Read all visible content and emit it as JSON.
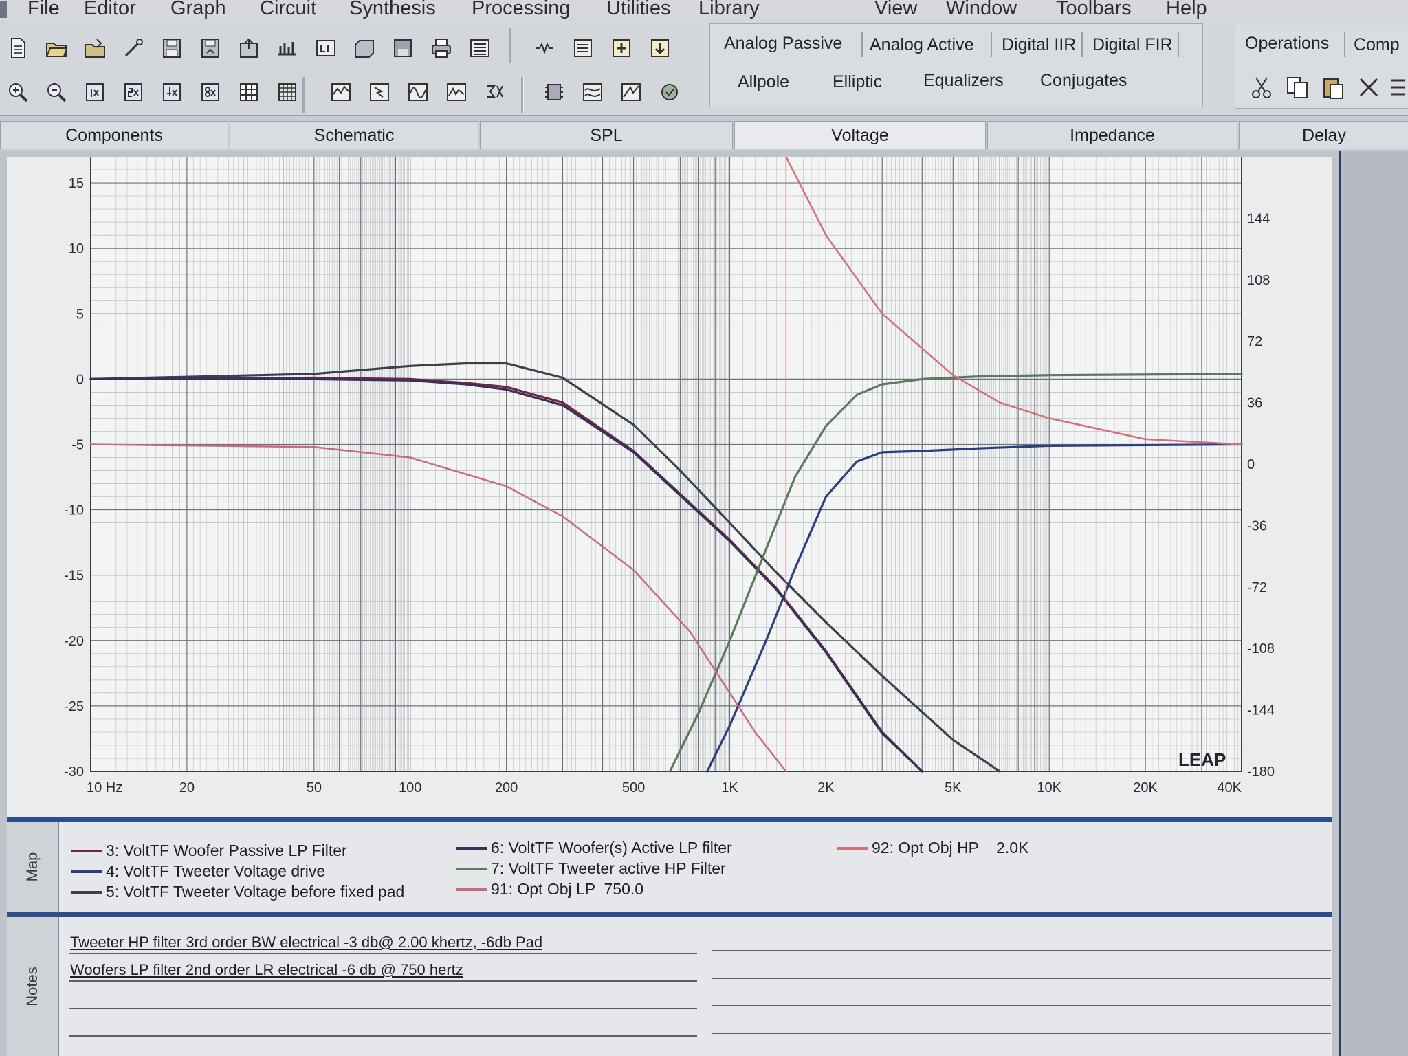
{
  "menu": [
    "File",
    "Editor",
    "Graph",
    "Circuit",
    "Synthesis",
    "Processing",
    "Utilities",
    "Library",
    "View",
    "Window",
    "Toolbars",
    "Help"
  ],
  "filter_tabs": {
    "row1": [
      "Analog Passive",
      "Analog Active",
      "Digital IIR",
      "Digital FIR"
    ],
    "row2": [
      "Allpole",
      "Elliptic",
      "Equalizers",
      "Conjugates"
    ]
  },
  "right_tabs": [
    "Operations",
    "Comp"
  ],
  "view_tabs": [
    "Components",
    "Schematic",
    "SPL",
    "Voltage",
    "Impedance",
    "Delay"
  ],
  "active_view_tab": "Voltage",
  "graph": {
    "watermark": "LEAP",
    "y_left_ticks": [
      "15",
      "10",
      "5",
      "0",
      "-5",
      "-10",
      "-15",
      "-20",
      "-25",
      "-30"
    ],
    "y_right_ticks": [
      "144",
      "108",
      "72",
      "36",
      "0",
      "-36",
      "-72",
      "-108",
      "-144",
      "-180"
    ],
    "x_ticks": [
      "10 Hz",
      "20",
      "50",
      "100",
      "200",
      "500",
      "1K",
      "2K",
      "5K",
      "10K",
      "20K",
      "40K"
    ]
  },
  "chart_data": {
    "type": "line",
    "xscale": "log",
    "xlim": [
      10,
      40000
    ],
    "ylim": [
      -30,
      17
    ],
    "ylim_right": [
      -180,
      180
    ],
    "grid": true,
    "series": [
      {
        "name": "3: VoltTF Woofer Passive LP Filter",
        "color": "#6b2a3e",
        "x": [
          10,
          50,
          100,
          150,
          200,
          300,
          500,
          700,
          1000,
          1400,
          2000,
          3000,
          4000
        ],
        "y": [
          0,
          0.1,
          0,
          -0.3,
          -0.6,
          -1.8,
          -5.5,
          -8.8,
          -12.3,
          -16,
          -20.8,
          -27,
          -31
        ]
      },
      {
        "name": "4: VoltTF Tweeter Voltage drive",
        "color": "#2c3f7c",
        "x": [
          850,
          1000,
          1300,
          1600,
          2000,
          2500,
          3000,
          4000,
          6000,
          10000,
          40000
        ],
        "y": [
          -30,
          -26.5,
          -20,
          -14.5,
          -9,
          -6.3,
          -5.6,
          -5.5,
          -5.3,
          -5.1,
          -5
        ]
      },
      {
        "name": "5: VoltTF Tweeter Voltage before fixed pad",
        "color": "#3c4048",
        "x": [
          10,
          50,
          100,
          150,
          200,
          300,
          500,
          700,
          1000,
          1400,
          2000,
          3000,
          5000,
          7000
        ],
        "y": [
          0,
          0.4,
          1,
          1.2,
          1.2,
          0.1,
          -3.5,
          -7,
          -11,
          -14.8,
          -18.6,
          -22.7,
          -27.6,
          -30.5
        ]
      },
      {
        "name": "6: VoltTF Woofer(s) Active LP filter",
        "color": "#3a2f5a",
        "x": [
          10,
          50,
          100,
          150,
          200,
          300,
          500,
          700,
          1000,
          1400,
          2000,
          3000,
          4000
        ],
        "y": [
          0,
          0,
          -0.1,
          -0.4,
          -0.8,
          -2,
          -5.6,
          -8.9,
          -12.4,
          -16.1,
          -20.9,
          -27.1,
          -31
        ]
      },
      {
        "name": "7: VoltTF Tweeter active HP Filter",
        "color": "#5c7a5a",
        "x": [
          650,
          800,
          1000,
          1300,
          1600,
          2000,
          2500,
          3000,
          4000,
          6000,
          10000,
          40000
        ],
        "y": [
          -30,
          -25.5,
          -20,
          -13,
          -7.5,
          -3.6,
          -1.2,
          -0.4,
          0,
          0.2,
          0.3,
          0.4
        ]
      },
      {
        "name": "91: Opt Obj LP  750.0",
        "color": "#c86a82",
        "x": [
          10,
          50,
          100,
          200,
          300,
          500,
          750,
          1000,
          1200,
          1500
        ],
        "y": [
          -5,
          -5.2,
          -6,
          -8.2,
          -10.5,
          -14.6,
          -19.3,
          -24,
          -27,
          -30.5
        ]
      },
      {
        "name": "92: Opt Obj HP    2.0K",
        "color": "#d26f7a",
        "x": [
          1500,
          2000,
          3000,
          5000,
          7000,
          10000,
          20000,
          40000
        ],
        "y": [
          17,
          11,
          5,
          0.3,
          -1.8,
          -3,
          -4.6,
          -5
        ]
      }
    ]
  },
  "legend_label": "Map",
  "notes_label": "Notes",
  "notes": [
    "Tweeter HP filter 3rd order BW electrical -3 db@ 2.00 khertz, -6db Pad",
    "Woofers LP filter 2nd order LR electrical -6 db @ 750 hertz"
  ]
}
